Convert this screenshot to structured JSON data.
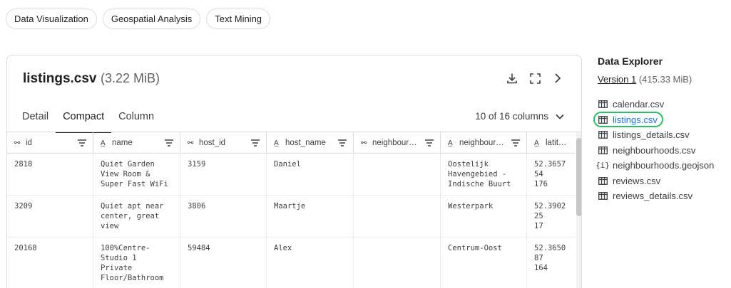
{
  "chips": [
    "Data Visualization",
    "Geospatial Analysis",
    "Text Mining"
  ],
  "card": {
    "title": "listings.csv",
    "size": "(3.22 MiB)",
    "icons": [
      "download-icon",
      "fullscreen-icon",
      "chevron-right-icon"
    ],
    "tabs": [
      {
        "label": "Detail",
        "active": false
      },
      {
        "label": "Compact",
        "active": true
      },
      {
        "label": "Column",
        "active": false
      }
    ],
    "column_count": "10 of 16 columns"
  },
  "table": {
    "columns": [
      {
        "type": "link",
        "label": "id"
      },
      {
        "type": "text",
        "label": "name"
      },
      {
        "type": "link",
        "label": "host_id"
      },
      {
        "type": "text",
        "label": "host_name"
      },
      {
        "type": "link",
        "label": "neighbour…"
      },
      {
        "type": "text",
        "label": "neighbour…"
      },
      {
        "type": "text",
        "label": "latitude"
      }
    ],
    "rows": [
      [
        "2818",
        "Quiet Garden\nView Room &\nSuper Fast WiFi",
        "3159",
        "Daniel",
        "",
        "Oostelijk\nHavengebied -\nIndische Buurt",
        "52.365754\n176"
      ],
      [
        "3209",
        "Quiet apt near\ncenter, great\nview",
        "3806",
        "Maartje",
        "",
        "Westerpark",
        "52.390225\n17"
      ],
      [
        "20168",
        "100%Centre-\nStudio 1\nPrivate\nFloor/Bathroom",
        "59484",
        "Alex",
        "",
        "Centrum-Oost",
        "52.365087\n164"
      ]
    ]
  },
  "side": {
    "title": "Data Explorer",
    "version_link": "Version 1",
    "version_size": "(415.33 MiB)",
    "files": [
      {
        "name": "calendar.csv",
        "icon": "table-icon",
        "active": false
      },
      {
        "name": "listings.csv",
        "icon": "table-icon",
        "active": true
      },
      {
        "name": "listings_details.csv",
        "icon": "table-icon",
        "active": false
      },
      {
        "name": "neighbourhoods.csv",
        "icon": "table-icon",
        "active": false
      },
      {
        "name": "neighbourhoods.geojson",
        "icon": "json-icon",
        "active": false
      },
      {
        "name": "reviews.csv",
        "icon": "table-icon",
        "active": false
      },
      {
        "name": "reviews_details.csv",
        "icon": "table-icon",
        "active": false
      }
    ]
  },
  "colors": {
    "highlight": "#22c55e",
    "active_link": "#1a73e8",
    "border": "#dadce0"
  }
}
